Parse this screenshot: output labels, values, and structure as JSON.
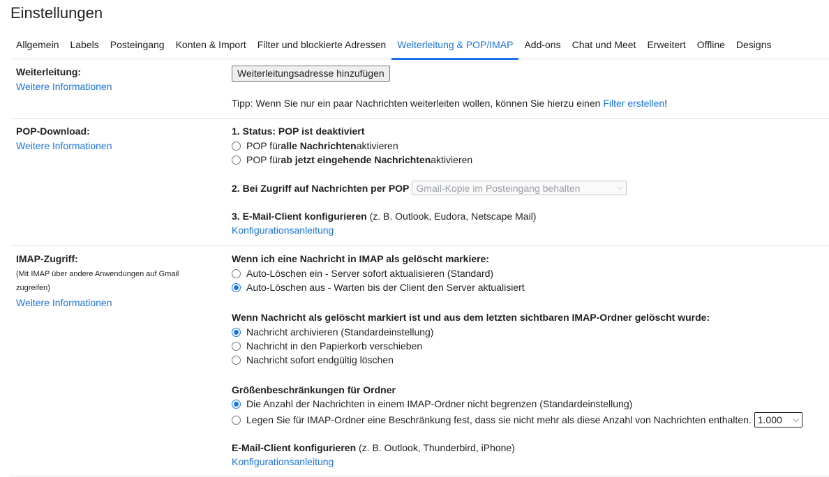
{
  "page": {
    "title": "Einstellungen"
  },
  "tabs": [
    {
      "label": "Allgemein"
    },
    {
      "label": "Labels"
    },
    {
      "label": "Posteingang"
    },
    {
      "label": "Konten & Import"
    },
    {
      "label": "Filter und blockierte Adressen"
    },
    {
      "label": "Weiterleitung & POP/IMAP",
      "active": true
    },
    {
      "label": "Add-ons"
    },
    {
      "label": "Chat und Meet"
    },
    {
      "label": "Erweitert"
    },
    {
      "label": "Offline"
    },
    {
      "label": "Designs"
    }
  ],
  "forwarding": {
    "label": "Weiterleitung:",
    "link": "Weitere Informationen",
    "add_button": "Weiterleitungsadresse hinzufügen",
    "tip_prefix": "Tipp: Wenn Sie nur ein paar Nachrichten weiterleiten wollen, können Sie hierzu einen ",
    "tip_link": "Filter erstellen",
    "tip_suffix": "!"
  },
  "pop": {
    "label": "POP-Download:",
    "link": "Weitere Informationen",
    "status": "1. Status: POP ist deaktiviert",
    "option1_prefix": "POP für ",
    "option1_bold": "alle Nachrichten",
    "option1_suffix": " aktivieren",
    "option2_prefix": "POP für ",
    "option2_bold": "ab jetzt eingehende Nachrichten",
    "option2_suffix": " aktivieren",
    "access_label": "2. Bei Zugriff auf Nachrichten per POP",
    "access_select": "Gmail-Kopie im Posteingang behalten",
    "client_bold": "3. E-Mail-Client konfigurieren",
    "client_rest": " (z. B. Outlook, Eudora, Netscape Mail)",
    "client_link": "Konfigurationsanleitung"
  },
  "imap": {
    "label": "IMAP-Zugriff:",
    "note": "(Mit IMAP über andere Anwendungen auf Gmail zugreifen)",
    "link": "Weitere Informationen",
    "deleted_heading": "Wenn ich eine Nachricht in IMAP als gelöscht markiere:",
    "deleted_options": [
      {
        "label": "Auto-Löschen ein - Server sofort aktualisieren (Standard)",
        "checked": false
      },
      {
        "label": "Auto-Löschen aus - Warten bis der Client den Server aktualisiert",
        "checked": true
      }
    ],
    "expunge_heading": "Wenn Nachricht als gelöscht markiert ist und aus dem letzten sichtbaren IMAP-Ordner gelöscht wurde:",
    "expunge_options": [
      {
        "label": "Nachricht archivieren (Standardeinstellung)",
        "checked": true
      },
      {
        "label": "Nachricht in den Papierkorb verschieben",
        "checked": false
      },
      {
        "label": "Nachricht sofort endgültig löschen",
        "checked": false
      }
    ],
    "size_heading": "Größenbeschränkungen für Ordner",
    "size_options": [
      {
        "label": "Die Anzahl der Nachrichten in einem IMAP-Ordner nicht begrenzen (Standardeinstellung)",
        "checked": true
      },
      {
        "label": "Legen Sie für IMAP-Ordner eine Beschränkung fest, dass sie nicht mehr als diese Anzahl von Nachrichten enthalten.",
        "checked": false
      }
    ],
    "size_select": "1.000",
    "client_bold": "E-Mail-Client konfigurieren",
    "client_rest": " (z. B. Outlook, Thunderbird, iPhone)",
    "client_link": "Konfigurationsanleitung"
  },
  "colors": {
    "accent": "#1a73e8",
    "text": "#202124",
    "divider": "#e0e0e0"
  }
}
